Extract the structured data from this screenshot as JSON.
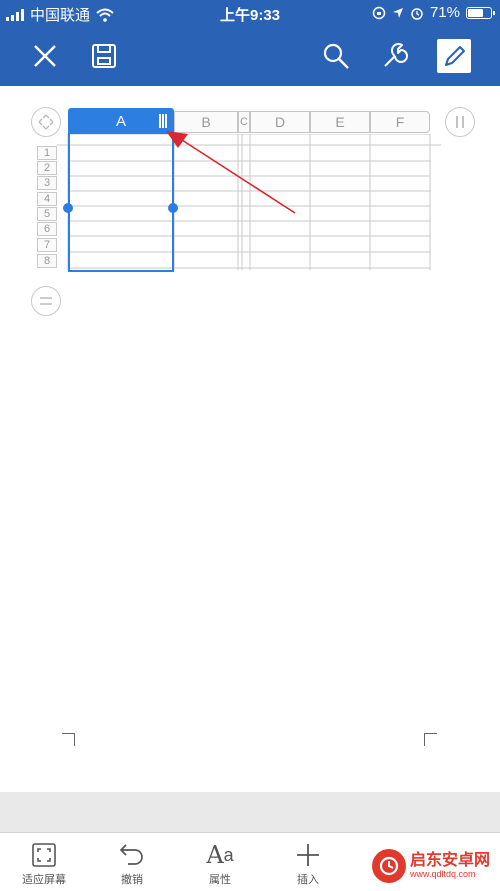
{
  "status_bar": {
    "carrier": "中国联通",
    "time": "上午9:33",
    "battery_percent": "71%",
    "battery_level": 0.71,
    "icons": [
      "signal-icon",
      "wifi-icon",
      "screen-rotation-lock-icon",
      "location-arrow-icon",
      "alarm-icon",
      "battery-icon"
    ]
  },
  "toolbar": {
    "icons": [
      "close-icon",
      "save-icon",
      "search-icon",
      "wrench-icon",
      "edit-pen-icon"
    ]
  },
  "spreadsheet": {
    "columns": [
      "A",
      "B",
      "C",
      "D",
      "E",
      "F"
    ],
    "rows": [
      "1",
      "2",
      "3",
      "4",
      "5",
      "6",
      "7",
      "8"
    ],
    "selected_column": "A",
    "accent_color": "#2c7fe0",
    "annotation_arrow_color": "#d9282f"
  },
  "bottom_bar": {
    "items": [
      {
        "label": "适应屏幕",
        "icon": "fit-screen-icon"
      },
      {
        "label": "撤销",
        "icon": "undo-icon"
      },
      {
        "label": "属性",
        "icon": "font-format-icon"
      },
      {
        "label": "插入",
        "icon": "plus-icon"
      }
    ]
  },
  "watermark": {
    "title": "启东安卓网",
    "url": "www.qdltdq.com"
  },
  "colors": {
    "app_bar": "#2a62b5",
    "selection": "#2c7fe0"
  }
}
